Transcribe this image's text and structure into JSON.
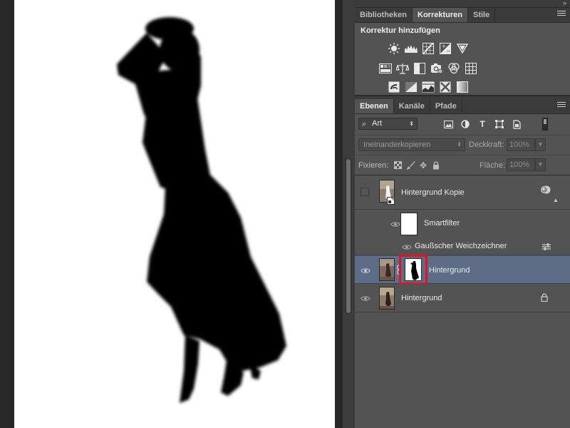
{
  "panel_tabs_top": [
    {
      "label": "Bibliotheken",
      "active": false
    },
    {
      "label": "Korrekturen",
      "active": true
    },
    {
      "label": "Stile",
      "active": false
    }
  ],
  "adjustments": {
    "title": "Korrektur hinzufügen",
    "row1": [
      "brightness-contrast-icon",
      "levels-icon",
      "curves-icon",
      "exposure-icon",
      "vibrance-icon"
    ],
    "row2": [
      "hue-saturation-icon",
      "color-balance-icon",
      "black-white-icon",
      "photo-filter-icon",
      "channel-mixer-icon",
      "color-lookup-icon"
    ],
    "row3": [
      "invert-icon",
      "posterize-icon",
      "threshold-icon",
      "selective-color-icon",
      "gradient-map-icon"
    ]
  },
  "layers_tabs": [
    {
      "label": "Ebenen",
      "active": true
    },
    {
      "label": "Kanäle",
      "active": false
    },
    {
      "label": "Pfade",
      "active": false
    }
  ],
  "layers_panel": {
    "filter_kind": "Art",
    "filter_icons": [
      "pixel-filter-icon",
      "adjustment-filter-icon",
      "type-filter-icon",
      "shape-filter-icon",
      "smartobject-filter-icon"
    ],
    "filter_type_glyph": "T",
    "blend_mode": "Ineinanderkopieren",
    "opacity_label": "Deckkraft:",
    "opacity_value": "100%",
    "lock_label": "Fixieren:",
    "fill_label": "Fläche:",
    "fill_value": "100%"
  },
  "layers": [
    {
      "name": "Hintergrund Kopie",
      "visible": false,
      "type": "smart-object"
    },
    {
      "name": "Smartfilter",
      "visible": true,
      "type": "smart-filter-mask"
    },
    {
      "name": "Gaußscher Weichzeichner",
      "visible": true,
      "type": "filter"
    },
    {
      "name": "Hintergrund",
      "visible": true,
      "type": "masked-layer",
      "selected": true
    },
    {
      "name": "Hintergrund",
      "visible": true,
      "type": "background",
      "locked": true
    }
  ],
  "colors": {
    "selection": "#5d6d87",
    "mask_highlight": "#e0141e",
    "panel_bg": "#535353",
    "canvas_bg": "#282828"
  }
}
